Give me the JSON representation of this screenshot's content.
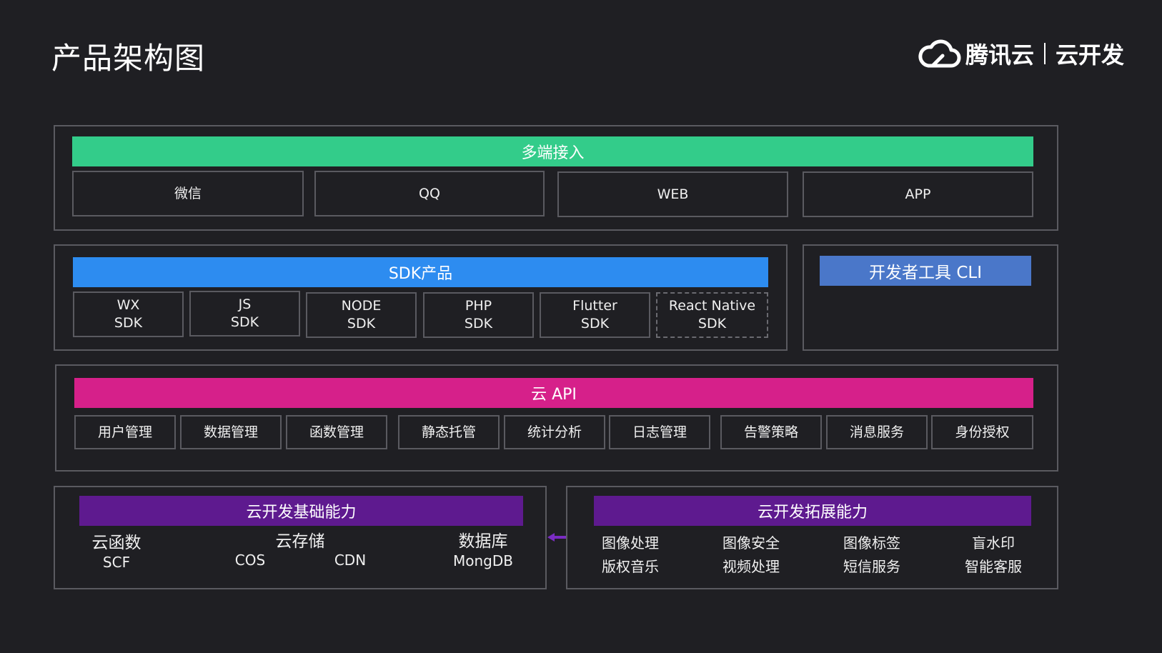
{
  "page": {
    "title": "产品架构图"
  },
  "logo": {
    "brand": "腾讯云",
    "product": "云开发"
  },
  "access": {
    "header": "多端接入",
    "items": [
      "微信",
      "QQ",
      "WEB",
      "APP"
    ]
  },
  "sdk": {
    "header": "SDK产品",
    "items": [
      {
        "line1": "WX",
        "line2": "SDK"
      },
      {
        "line1": "JS",
        "line2": "SDK"
      },
      {
        "line1": "NODE",
        "line2": "SDK"
      },
      {
        "line1": "PHP",
        "line2": "SDK"
      },
      {
        "line1": "Flutter",
        "line2": "SDK"
      },
      {
        "line1": "React Native",
        "line2": "SDK"
      }
    ]
  },
  "cli": {
    "header": "开发者工具 CLI"
  },
  "api": {
    "header": "云 API",
    "items": [
      "用户管理",
      "数据管理",
      "函数管理",
      "静态托管",
      "统计分析",
      "日志管理",
      "告警策略",
      "消息服务",
      "身份授权"
    ]
  },
  "base": {
    "header": "云开发基础能力",
    "functions": {
      "name": "云函数",
      "code": "SCF"
    },
    "storage": {
      "name": "云存储",
      "cos": "COS",
      "cdn": "CDN"
    },
    "database": {
      "name": "数据库",
      "code": "MongDB"
    }
  },
  "ext": {
    "header": "云开发拓展能力",
    "items": [
      [
        "图像处理",
        "版权音乐"
      ],
      [
        "图像安全",
        "视频处理"
      ],
      [
        "图像标签",
        "短信服务"
      ],
      [
        "盲水印",
        "智能客服"
      ]
    ]
  },
  "colors": {
    "access": "#33cc8a",
    "sdk": "#2d8cf0",
    "cli": "#4a77c9",
    "api": "#d6208a",
    "base": "#5e1a8f",
    "arrow": "#7a2cc2",
    "border": "#5a5a60",
    "background": "#1f1f23"
  }
}
